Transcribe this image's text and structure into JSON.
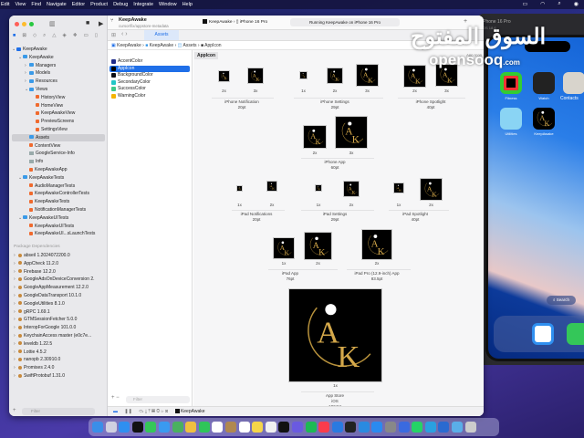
{
  "menubar": {
    "items": [
      "Edit",
      "View",
      "Find",
      "Navigate",
      "Editor",
      "Product",
      "Debug",
      "Integrate",
      "Window",
      "Help"
    ]
  },
  "window": {
    "project": "KeepAwake",
    "branch": "cursor/fix/appstore-metadata",
    "scheme": "KeepAwake",
    "device": "iPhone 16 Pro",
    "status": "Running KeepAwake on iPhone 16 Pro",
    "tab": "Assets"
  },
  "breadcrumb": [
    "KeepAwake",
    "KeepAwake",
    "Assets",
    "AppIcon"
  ],
  "navigator": {
    "tree": [
      {
        "l": 0,
        "t": "KeepAwake",
        "k": "proj",
        "o": 1
      },
      {
        "l": 1,
        "t": "KeepAwake",
        "k": "folder",
        "o": 1
      },
      {
        "l": 2,
        "t": "Managers",
        "k": "folder",
        "o": 0
      },
      {
        "l": 2,
        "t": "Models",
        "k": "folder",
        "o": 0
      },
      {
        "l": 2,
        "t": "Resources",
        "k": "folder",
        "o": 0
      },
      {
        "l": 2,
        "t": "Views",
        "k": "folder",
        "o": 1
      },
      {
        "l": 3,
        "t": "HistoryView",
        "k": "swift"
      },
      {
        "l": 3,
        "t": "HomeView",
        "k": "swift"
      },
      {
        "l": 3,
        "t": "KeepAwakeView",
        "k": "swift"
      },
      {
        "l": 3,
        "t": "PreviewScreens",
        "k": "swift"
      },
      {
        "l": 3,
        "t": "SettingsView",
        "k": "swift"
      },
      {
        "l": 2,
        "t": "Assets",
        "k": "assets",
        "sel": true
      },
      {
        "l": 2,
        "t": "ContentView",
        "k": "swift"
      },
      {
        "l": 2,
        "t": "GoogleService-Info",
        "k": "plist"
      },
      {
        "l": 2,
        "t": "Info",
        "k": "plist"
      },
      {
        "l": 2,
        "t": "KeepAwakeApp",
        "k": "swift"
      },
      {
        "l": 1,
        "t": "KeepAwakeTests",
        "k": "folder",
        "o": 1
      },
      {
        "l": 2,
        "t": "AudioManagerTests",
        "k": "swift"
      },
      {
        "l": 2,
        "t": "KeepAwakeControllerTests",
        "k": "swift"
      },
      {
        "l": 2,
        "t": "KeepAwakeTests",
        "k": "swift"
      },
      {
        "l": 2,
        "t": "NotificationManagerTests",
        "k": "swift"
      },
      {
        "l": 1,
        "t": "KeepAwakeUITests",
        "k": "folder",
        "o": 1
      },
      {
        "l": 2,
        "t": "KeepAwakeUITests",
        "k": "swift"
      },
      {
        "l": 2,
        "t": "KeepAwakeUI...sLaunchTests",
        "k": "swift"
      }
    ],
    "packages_header": "Package Dependencies",
    "packages": [
      "abseil 1.2024072200.0",
      "AppCheck 11.2.0",
      "Firebase 12.2.0",
      "GoogleAdsOnDeviceConversion 2.",
      "GoogleAppMeasurement 12.2.0",
      "GoogleDataTransport 10.1.0",
      "GoogleUtilities 8.1.0",
      "gRPC 1.69.1",
      "GTMSessionFetcher 5.0.0",
      "InteropForGoogle 101.0.0",
      "KeychainAccess master (e0c7e...",
      "leveldb 1.22.5",
      "Lottie 4.5.2",
      "nanopb 2.30910.0",
      "Promises 2.4.0",
      "SwiftProtobuf 1.31.0"
    ],
    "filter_placeholder": "Filter"
  },
  "assets": {
    "items": [
      {
        "name": "AccentColor",
        "color": "#1d2a8a"
      },
      {
        "name": "AppIcon",
        "color": "#000000"
      },
      {
        "name": "BackgroundColor",
        "color": "#0d0d14"
      },
      {
        "name": "SecondaryColor",
        "color": "#22c6c6"
      },
      {
        "name": "SuccessColor",
        "color": "#3ec98a"
      },
      {
        "name": "WarningColor",
        "color": "#f5b400"
      }
    ],
    "selected": "AppIcon",
    "filter_placeholder": "Filter"
  },
  "detail": {
    "header": "AppIcon",
    "corner_label": "App Icon",
    "scales": {
      "x1": "1x",
      "x2": "2x",
      "x3": "3x"
    },
    "groups": {
      "iphone_notification": [
        "iPhone Notification",
        "20pt"
      ],
      "iphone_settings": [
        "iPhone Settings",
        "29pt"
      ],
      "iphone_spotlight": [
        "iPhone Spotlight",
        "40pt"
      ],
      "iphone_app": [
        "iPhone App",
        "60pt"
      ],
      "ipad_notifications": [
        "iPad Notifications",
        "20pt"
      ],
      "ipad_settings": [
        "iPad Settings",
        "29pt"
      ],
      "ipad_spotlight": [
        "iPad Spotlight",
        "40pt"
      ],
      "ipad_app": [
        "iPad App",
        "76pt"
      ],
      "ipad_pro": [
        "iPad Pro (12.9-inch) App",
        "83.5pt"
      ],
      "app_store": [
        "App Store",
        "iOS",
        "1024pt"
      ]
    },
    "logo": "AK KEEP AWAKE"
  },
  "debugbar": {
    "target": "KeepAwake"
  },
  "simulator": {
    "title": "iPhone 16 Pro",
    "os": "iOS 18.6",
    "apps": [
      "Fitness",
      "Watch",
      "Contacts",
      "Utilities",
      "KeepAwake"
    ],
    "search": "Search"
  },
  "watermark": {
    "arabic": "السوق المفتوح",
    "latin": "opensooq",
    "suffix": ".com"
  },
  "dock": [
    [
      "finder",
      "#3a8ee8"
    ],
    [
      "launchpad",
      "#d0d0e0"
    ],
    [
      "safari",
      "#2f8ff0"
    ],
    [
      "activity",
      "#111"
    ],
    [
      "messages",
      "#35c759"
    ],
    [
      "mail",
      "#3a9af0"
    ],
    [
      "maps",
      "#4ab060"
    ],
    [
      "photos",
      "#f0c040"
    ],
    [
      "facetime",
      "#2fc55a"
    ],
    [
      "calendar",
      "#fff"
    ],
    [
      "notes-brown",
      "#b08850"
    ],
    [
      "reminders",
      "#fff"
    ],
    [
      "notes",
      "#f5d54a"
    ],
    [
      "freeform",
      "#f0f0f0"
    ],
    [
      "appletv",
      "#111"
    ],
    [
      "starred",
      "#6a5ae0"
    ],
    [
      "spotify",
      "#1db954"
    ],
    [
      "music",
      "#fa3c4c"
    ],
    [
      "xcode-tools",
      "#2a7ae0"
    ],
    [
      "terminal-app",
      "#222"
    ],
    [
      "vscode",
      "#2a8ae0"
    ],
    [
      "appstore",
      "#2a8af0"
    ],
    [
      "settings",
      "#888"
    ],
    [
      "simulator",
      "#3a6ae0"
    ],
    [
      "whatsapp",
      "#25d366"
    ],
    [
      "telegram",
      "#2aa0e0"
    ],
    [
      "xcode",
      "#2a6ad0"
    ],
    [
      "downloads",
      "#5aaee8"
    ],
    [
      "trash",
      "#ccc"
    ]
  ]
}
